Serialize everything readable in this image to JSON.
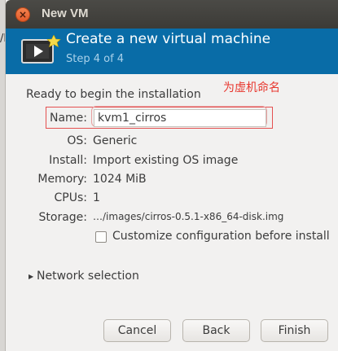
{
  "background": {
    "text_fragment": "/kv"
  },
  "window": {
    "title": "New VM",
    "close_glyph": "×"
  },
  "header": {
    "title": "Create a new virtual machine",
    "subtitle": "Step 4 of 4",
    "icon": "virtual-machine-monitor-icon"
  },
  "body": {
    "intro": "Ready to begin the installation",
    "annotation": "为虚机命名",
    "fields": {
      "name_label": "Name:",
      "name_value": "kvm1_cirros",
      "os_label": "OS:",
      "os_value": "Generic",
      "install_label": "Install:",
      "install_value": "Import existing OS image",
      "memory_label": "Memory:",
      "memory_value": "1024 MiB",
      "cpus_label": "CPUs:",
      "cpus_value": "1",
      "storage_label": "Storage:",
      "storage_value": "…/images/cirros-0.5.1-x86_64-disk.img"
    },
    "customize_label": "Customize configuration before install",
    "network_label": "Network selection"
  },
  "buttons": {
    "cancel": "Cancel",
    "back": "Back",
    "finish": "Finish"
  },
  "colors": {
    "header_bg": "#096ca7",
    "annotation": "#e8382f",
    "titlebar": "#3c3b37"
  }
}
